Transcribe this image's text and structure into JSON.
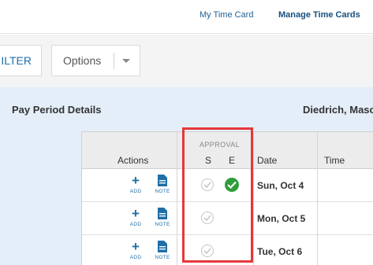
{
  "nav": {
    "my_time_card": "My Time Card",
    "manage_time_cards": "Manage Time Cards"
  },
  "toolbar": {
    "filter_label": "ILTER",
    "options_label": "Options"
  },
  "panel": {
    "title": "Pay Period Details",
    "employee": "Diedrich, Masc"
  },
  "table": {
    "headers": {
      "actions": "Actions",
      "approval": "APPROVAL",
      "s": "S",
      "e": "E",
      "date": "Date",
      "time": "Time"
    },
    "action_labels": {
      "add": "ADD",
      "note": "NOTE"
    },
    "rows": [
      {
        "date": "Sun, Oct 4",
        "supervisor_approved": false,
        "employee_approved": true
      },
      {
        "date": "Mon, Oct 5",
        "supervisor_approved": false,
        "employee_approved": false
      },
      {
        "date": "Tue, Oct 6",
        "supervisor_approved": false,
        "employee_approved": false
      }
    ]
  },
  "colors": {
    "accent": "#1f6fa8",
    "approved": "#2e9d3a",
    "highlight": "#e5383b",
    "panel_bg": "#e4eef8"
  }
}
